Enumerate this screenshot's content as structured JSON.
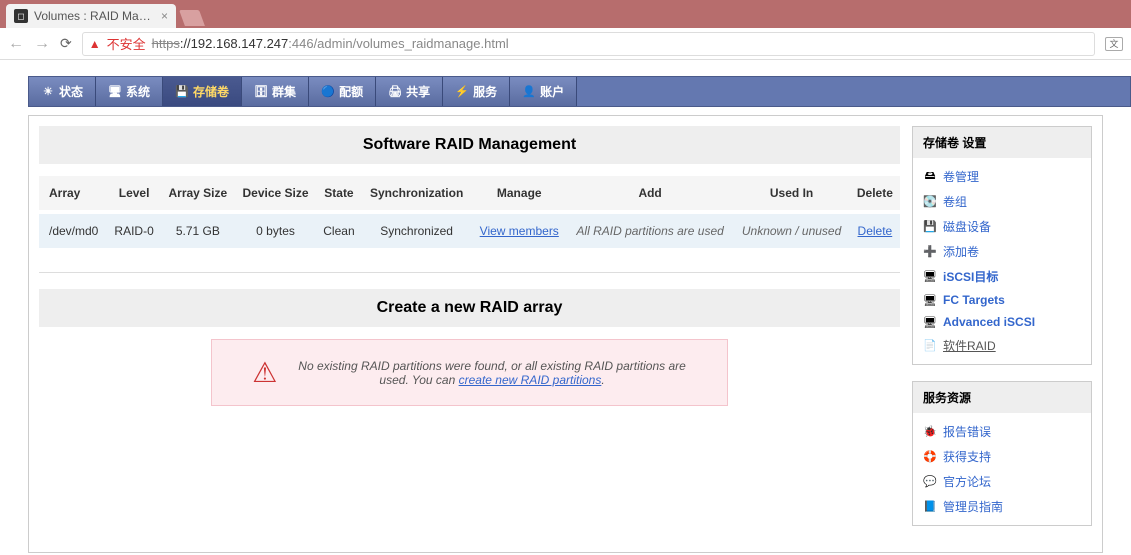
{
  "browser": {
    "tab_title": "Volumes : RAID Mana...",
    "insecure_label": "不安全",
    "url_scheme": "https",
    "url_host": "://192.168.147.247",
    "url_port_path": ":446/admin/volumes_raidmanage.html"
  },
  "topnav": {
    "items": [
      {
        "label": "状态",
        "icon": "☀"
      },
      {
        "label": "系统",
        "icon": "🖥"
      },
      {
        "label": "存储卷",
        "icon": "💾",
        "active": true
      },
      {
        "label": "群集",
        "icon": "🗄"
      },
      {
        "label": "配额",
        "icon": "🔵"
      },
      {
        "label": "共享",
        "icon": "🖨"
      },
      {
        "label": "服务",
        "icon": "⚡"
      },
      {
        "label": "账户",
        "icon": "👤"
      }
    ]
  },
  "panel_raid": {
    "title": "Software RAID Management",
    "headers": [
      "Array",
      "Level",
      "Array Size",
      "Device Size",
      "State",
      "Synchronization",
      "Manage",
      "Add",
      "Used In",
      "Delete"
    ],
    "row": {
      "array": "/dev/md0",
      "level": "RAID-0",
      "array_size": "5.71 GB",
      "device_size": "0 bytes",
      "state": "Clean",
      "sync": "Synchronized",
      "manage_link": "View members",
      "add_text": "All RAID partitions are used",
      "used_in": "Unknown / unused",
      "delete_link": "Delete"
    }
  },
  "panel_create": {
    "title": "Create a new RAID array",
    "warn_pre": "No existing RAID partitions were found, or all existing RAID partitions are used. You can ",
    "warn_link": "create new RAID partitions",
    "warn_post": "."
  },
  "sidebar": {
    "settings_title": "存储卷 设置",
    "resources_title": "服务资源",
    "settings": [
      {
        "label": "卷管理",
        "icon": "🖴"
      },
      {
        "label": "卷组",
        "icon": "💽"
      },
      {
        "label": "磁盘设备",
        "icon": "💾"
      },
      {
        "label": "添加卷",
        "icon": "➕"
      },
      {
        "label": "iSCSI目标",
        "icon": "🖥",
        "bold": true
      },
      {
        "label": "FC Targets",
        "icon": "🖥",
        "bold": true
      },
      {
        "label": "Advanced iSCSI",
        "icon": "🖥",
        "bold": true
      },
      {
        "label": "软件RAID",
        "icon": "📄",
        "current": true
      }
    ],
    "resources": [
      {
        "label": "报告错误",
        "icon": "🐞"
      },
      {
        "label": "获得支持",
        "icon": "🛟"
      },
      {
        "label": "官方论坛",
        "icon": "💬"
      },
      {
        "label": "管理员指南",
        "icon": "📘"
      }
    ]
  }
}
